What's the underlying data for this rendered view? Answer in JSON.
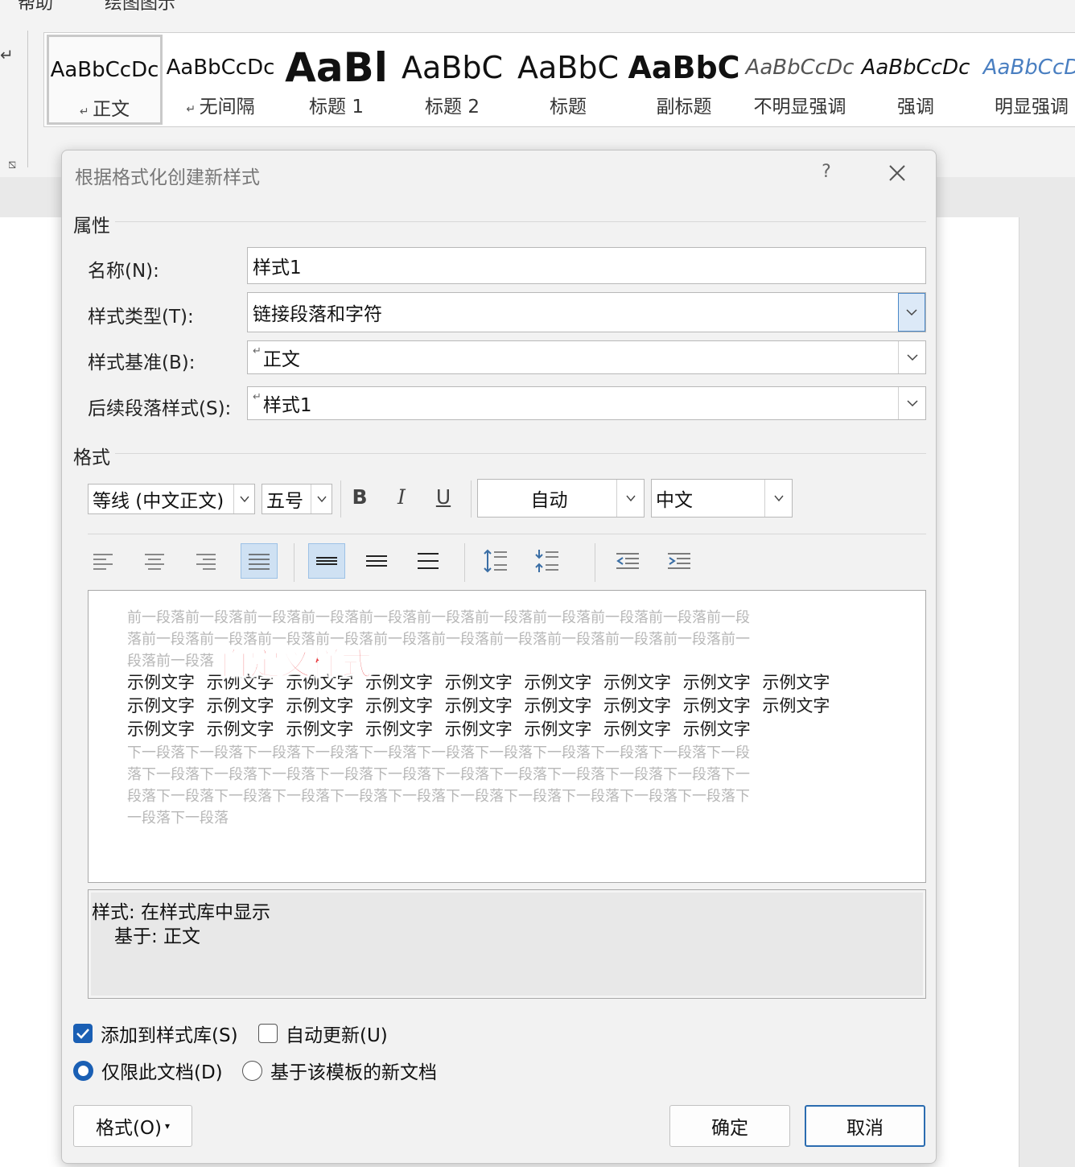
{
  "ribbon": {
    "tabs": [
      "帮助",
      "绘图图示"
    ],
    "gallery": [
      {
        "sample": "AaBbCcDc",
        "name": "正文",
        "pilcrow": true
      },
      {
        "sample": "AaBbCcDc",
        "name": "无间隔",
        "pilcrow": true
      },
      {
        "sample": "AaBl",
        "name": "标题 1",
        "pilcrow": false
      },
      {
        "sample": "AaBbC",
        "name": "标题 2",
        "pilcrow": false
      },
      {
        "sample": "AaBbC",
        "name": "标题",
        "pilcrow": false
      },
      {
        "sample": "AaBbC",
        "name": "副标题",
        "pilcrow": false
      },
      {
        "sample": "AaBbCcDc",
        "name": "不明显强调",
        "pilcrow": false
      },
      {
        "sample": "AaBbCcDc",
        "name": "强调",
        "pilcrow": false
      },
      {
        "sample": "AaBbCcD",
        "name": "明显强调",
        "pilcrow": false
      }
    ]
  },
  "dialog": {
    "title": "根据格式化创建新样式",
    "help": "?",
    "properties": {
      "section_title": "属性",
      "name_label": "名称(N):",
      "name_value": "样式1",
      "type_label": "样式类型(T):",
      "type_value": "链接段落和字符",
      "based_label": "样式基准(B):",
      "based_value": "正文",
      "next_label": "后续段落样式(S):",
      "next_value": "样式1"
    },
    "format": {
      "section_title": "格式",
      "font": "等线 (中文正文)",
      "size": "五号",
      "bold": "B",
      "italic": "I",
      "underline": "U",
      "color": "自动",
      "language": "中文"
    },
    "preview": {
      "prev_lines": [
        "前一段落前一段落前一段落前一段落前一段落前一段落前一段落前一段落前一段落前一段落前一段",
        "落前一段落前一段落前一段落前一段落前一段落前一段落前一段落前一段落前一段落前一段落前一",
        "段落前一段落"
      ],
      "sample_lines": [
        "示例文字 示例文字 示例文字 示例文字 示例文字 示例文字 示例文字 示例文字 示例文字",
        "示例文字 示例文字 示例文字 示例文字 示例文字 示例文字 示例文字 示例文字 示例文字",
        "示例文字 示例文字 示例文字 示例文字 示例文字 示例文字 示例文字 示例文字"
      ],
      "next_lines": [
        "下一段落下一段落下一段落下一段落下一段落下一段落下一段落下一段落下一段落下一段落下一段",
        "落下一段落下一段落下一段落下一段落下一段落下一段落下一段落下一段落下一段落下一段落下一",
        "段落下一段落下一段落下一段落下一段落下一段落下一段落下一段落下一段落下一段落下一段落下",
        "一段落下一段落"
      ],
      "overlay_label": "自定义样式"
    },
    "description": {
      "line1": "样式: 在样式库中显示",
      "line2": "基于: 正文"
    },
    "options": {
      "add_to_gallery": "添加到样式库(S)",
      "add_to_gallery_checked": true,
      "auto_update": "自动更新(U)",
      "auto_update_checked": false,
      "this_doc_only": "仅限此文档(D)",
      "this_doc_only_selected": true,
      "new_docs_template": "基于该模板的新文档",
      "new_docs_template_selected": false
    },
    "buttons": {
      "format": "格式(O)",
      "ok": "确定",
      "cancel": "取消"
    }
  },
  "colors": {
    "accent": "#1a5fb4",
    "overlay_text": "#e8383d",
    "heading_blue": "#4a7fc1"
  }
}
